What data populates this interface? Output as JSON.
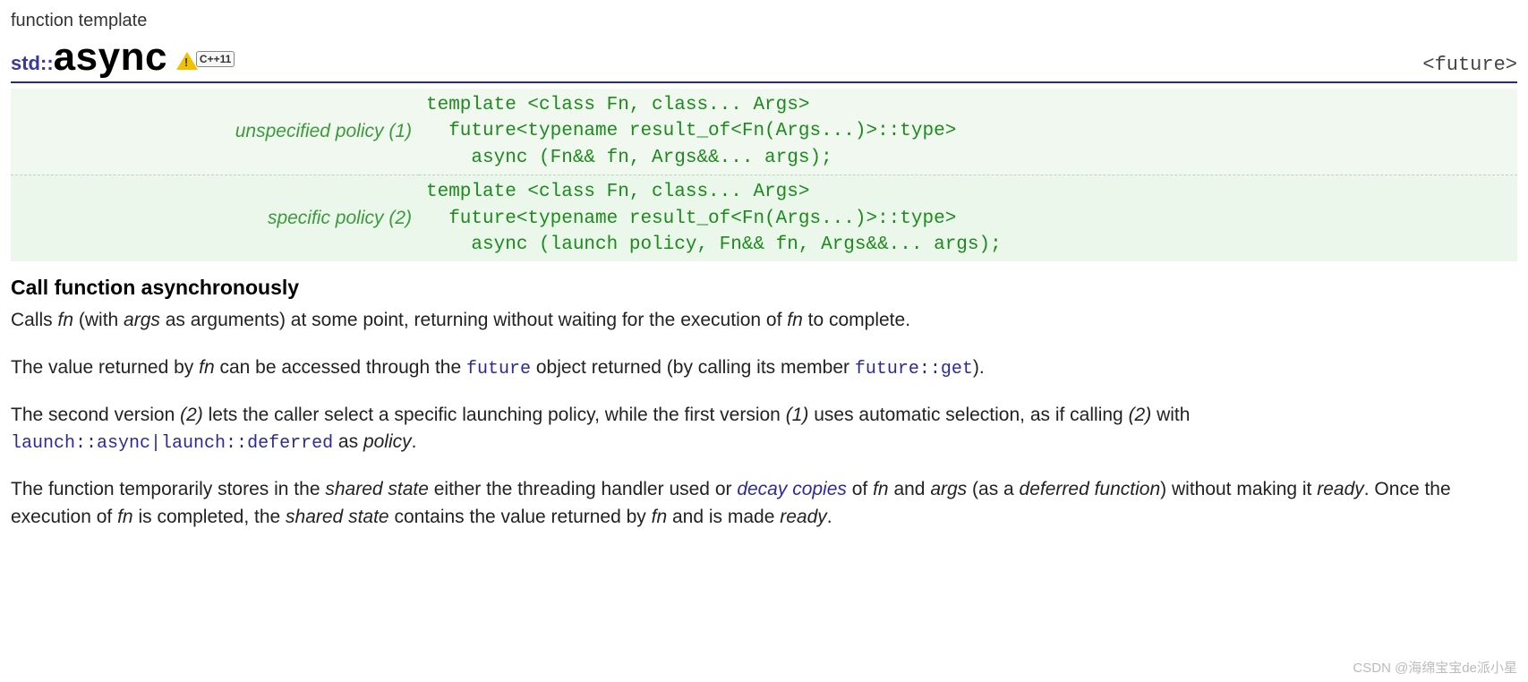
{
  "overline": "function template",
  "namespace": "std::",
  "fn_name": "async",
  "cpp_badge": "C++11",
  "header_include": "<future>",
  "signatures": [
    {
      "label": "unspecified policy (1)",
      "code": "template <class Fn, class... Args>\n  future<typename result_of<Fn(Args...)>::type>\n    async (Fn&& fn, Args&&... args);"
    },
    {
      "label": "specific policy (2)",
      "code": "template <class Fn, class... Args>\n  future<typename result_of<Fn(Args...)>::type>\n    async (launch policy, Fn&& fn, Args&&... args);"
    }
  ],
  "section_title": "Call function asynchronously",
  "para1": {
    "t1": "Calls ",
    "fn": "fn",
    "t2": " (with ",
    "args": "args",
    "t3": " as arguments) at some point, returning without waiting for the execution of ",
    "fn2": "fn",
    "t4": " to complete."
  },
  "para2": {
    "t1": "The value returned by ",
    "fn": "fn",
    "t2": " can be accessed through the ",
    "future": "future",
    "t3": " object returned (by calling its member ",
    "future_get": "future::get",
    "t4": ")."
  },
  "para3": {
    "t1": "The second version ",
    "v2": "(2)",
    "t2": " lets the caller select a specific launching policy, while the first version ",
    "v1": "(1)",
    "t3": " uses automatic selection, as if calling ",
    "v2b": "(2)",
    "t4": " with ",
    "launch_async": "launch::async",
    "pipe": "|",
    "launch_deferred": "launch::deferred",
    "t5": " as ",
    "policy": "policy",
    "t6": "."
  },
  "para4": {
    "t1": "The function temporarily stores in the ",
    "ss1": "shared state",
    "t2": " either the threading handler used or ",
    "decay": "decay copies",
    "t3": " of ",
    "fn": "fn",
    "t4": " and ",
    "args": "args",
    "t5": " (as a ",
    "deferred": "deferred function",
    "t6": ") without making it ",
    "ready1": "ready",
    "t7": ". Once the execution of ",
    "fn2": "fn",
    "t8": " is completed, the ",
    "ss2": "shared state",
    "t9": " contains the value returned by ",
    "fn3": "fn",
    "t10": " and is made ",
    "ready2": "ready",
    "t11": "."
  },
  "watermark": "CSDN @海绵宝宝de派小星"
}
